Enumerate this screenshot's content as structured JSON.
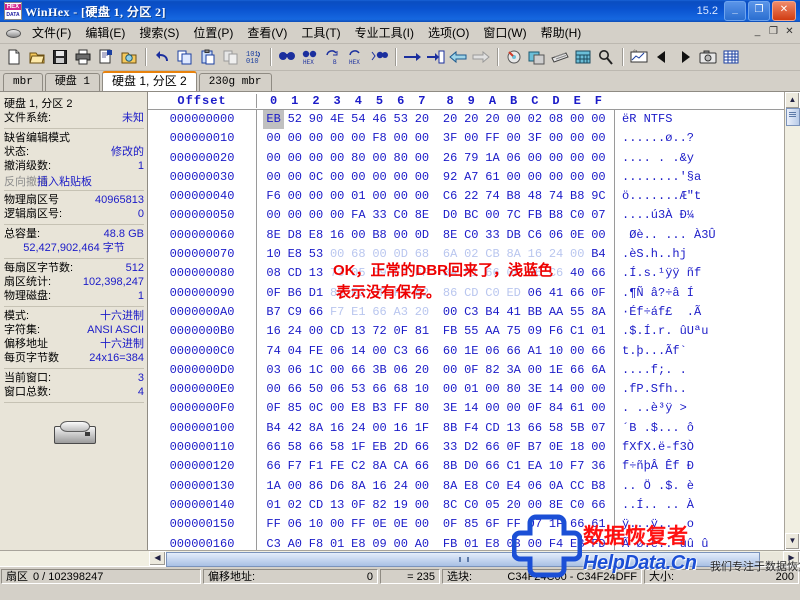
{
  "titlebar": {
    "title": "WinHex - [硬盘 1, 分区 2]",
    "version": "15.2",
    "minimize": "_",
    "maximize": "❐",
    "close": "✕"
  },
  "menu": {
    "items": [
      {
        "label": "文件(F)"
      },
      {
        "label": "编辑(E)"
      },
      {
        "label": "搜索(S)"
      },
      {
        "label": "位置(P)"
      },
      {
        "label": "查看(V)"
      },
      {
        "label": "工具(T)"
      },
      {
        "label": "专业工具(I)"
      },
      {
        "label": "选项(O)"
      },
      {
        "label": "窗口(W)"
      },
      {
        "label": "帮助(H)"
      }
    ],
    "mdi": {
      "minimize": "_",
      "restore": "❐",
      "close": "✕"
    }
  },
  "toolbar": {
    "buttons": [
      {
        "name": "new-file-icon",
        "glyph": "🗋"
      },
      {
        "name": "open-file-icon",
        "glyph": "📂"
      },
      {
        "name": "save-icon",
        "glyph": "💾"
      },
      {
        "name": "print-icon",
        "glyph": "🖨"
      },
      {
        "name": "properties-icon",
        "glyph": "🗒"
      },
      {
        "name": "open-disk-icon",
        "glyph": "📁"
      },
      {
        "name": "undo-icon",
        "glyph": "↶"
      },
      {
        "name": "copy-icon",
        "glyph": "⎘"
      },
      {
        "name": "paste-icon",
        "glyph": "📋"
      },
      {
        "name": "clipboard-data-icon",
        "glyph": "🗐"
      },
      {
        "name": "binary-101-icon",
        "glyph": "101"
      },
      {
        "name": "find-text-icon",
        "glyph": "🔍"
      },
      {
        "name": "find-hex-icon",
        "glyph": "HEX"
      },
      {
        "name": "replace-text-icon",
        "glyph": "↻"
      },
      {
        "name": "replace-hex-icon",
        "glyph": "HEX"
      },
      {
        "name": "find-all-icon",
        "glyph": "🔎"
      },
      {
        "name": "goto-offset-icon",
        "glyph": "→"
      },
      {
        "name": "goto-sector-icon",
        "glyph": "⇥"
      },
      {
        "name": "navigate-back-icon",
        "glyph": "⬅"
      },
      {
        "name": "navigate-forward-icon",
        "glyph": "➡"
      },
      {
        "name": "disk-tools-icon",
        "glyph": "💿"
      },
      {
        "name": "backup-icon",
        "glyph": "🖫"
      },
      {
        "name": "ram-icon",
        "glyph": "▤"
      },
      {
        "name": "calculator-icon",
        "glyph": "🖩"
      },
      {
        "name": "analyze-icon",
        "glyph": "🔍"
      },
      {
        "name": "graph-icon",
        "glyph": "📈"
      },
      {
        "name": "prev-icon",
        "glyph": "◀"
      },
      {
        "name": "next-icon",
        "glyph": "▶"
      },
      {
        "name": "snapshot-icon",
        "glyph": "📷"
      },
      {
        "name": "table-icon",
        "glyph": "▦"
      }
    ]
  },
  "tabs": [
    {
      "label": "mbr",
      "active": false
    },
    {
      "label": "硬盘 1",
      "active": false
    },
    {
      "label": "硬盘 1, 分区 2",
      "active": true
    },
    {
      "label": "230g mbr",
      "active": false
    }
  ],
  "infopane": {
    "groups": [
      {
        "rows": [
          {
            "key": "硬盘 1, 分区 2",
            "value": ""
          },
          {
            "key": "文件系统:",
            "value": "未知"
          }
        ]
      },
      {
        "rows": [
          {
            "key": "缺省编辑模式",
            "value": ""
          },
          {
            "key": "状态:",
            "value": "修改的"
          },
          {
            "key": "撤消级数:",
            "value": "1"
          },
          {
            "key": "反向撤消",
            "value": "插入粘贴板",
            "overlap": true
          }
        ]
      },
      {
        "rows": [
          {
            "key": "物理扇区号",
            "value": "40965813"
          },
          {
            "key": "逻辑扇区号:",
            "value": "0"
          }
        ]
      },
      {
        "rows": [
          {
            "key": "总容量:",
            "value": "48.8 GB"
          },
          {
            "key": "",
            "value": "52,427,902,464 字节",
            "center": true
          }
        ]
      },
      {
        "rows": [
          {
            "key": "每扇区字节数:",
            "value": "512"
          },
          {
            "key": "扇区统计:",
            "value": "102,398,247"
          },
          {
            "key": "物理磁盘:",
            "value": "1"
          }
        ]
      },
      {
        "rows": [
          {
            "key": "模式:",
            "value": "十六进制"
          },
          {
            "key": "字符集:",
            "value": "ANSI ASCII"
          },
          {
            "key": "偏移地址",
            "value": "十六进制"
          },
          {
            "key": "每页字节数",
            "value": "24x16=384"
          }
        ]
      },
      {
        "rows": [
          {
            "key": "当前窗口:",
            "value": "3"
          },
          {
            "key": "窗口总数:",
            "value": "4"
          }
        ]
      }
    ],
    "disk_icon": "hard-disk-icon"
  },
  "hexview": {
    "offset_header": "Offset",
    "columns": [
      "0",
      "1",
      "2",
      "3",
      "4",
      "5",
      "6",
      "7",
      "8",
      "9",
      "A",
      "B",
      "C",
      "D",
      "E",
      "F"
    ],
    "rows": [
      {
        "offset": "000000000",
        "bytes": [
          "EB",
          "52",
          "90",
          "4E",
          "54",
          "46",
          "53",
          "20",
          "20",
          "20",
          "20",
          "00",
          "02",
          "08",
          "00",
          "00"
        ],
        "unsaved": [],
        "sel": [
          0
        ],
        "ascii": "ëR NTFS"
      },
      {
        "offset": "000000010",
        "bytes": [
          "00",
          "00",
          "00",
          "00",
          "00",
          "F8",
          "00",
          "00",
          "3F",
          "00",
          "FF",
          "00",
          "3F",
          "00",
          "00",
          "00"
        ],
        "unsaved": [],
        "sel": [],
        "ascii": "......ø..?"
      },
      {
        "offset": "000000020",
        "bytes": [
          "00",
          "00",
          "00",
          "00",
          "80",
          "00",
          "80",
          "00",
          "26",
          "79",
          "1A",
          "06",
          "00",
          "00",
          "00",
          "00"
        ],
        "unsaved": [],
        "sel": [],
        "ascii": ".... . .&y"
      },
      {
        "offset": "000000030",
        "bytes": [
          "00",
          "00",
          "0C",
          "00",
          "00",
          "00",
          "00",
          "00",
          "92",
          "A7",
          "61",
          "00",
          "00",
          "00",
          "00",
          "00"
        ],
        "unsaved": [],
        "sel": [],
        "ascii": "........'§a"
      },
      {
        "offset": "000000040",
        "bytes": [
          "F6",
          "00",
          "00",
          "00",
          "01",
          "00",
          "00",
          "00",
          "C6",
          "22",
          "74",
          "B8",
          "48",
          "74",
          "B8",
          "9C"
        ],
        "unsaved": [],
        "sel": [],
        "ascii": "ö.......Æ\"t"
      },
      {
        "offset": "000000050",
        "bytes": [
          "00",
          "00",
          "00",
          "00",
          "FA",
          "33",
          "C0",
          "8E",
          "D0",
          "BC",
          "00",
          "7C",
          "FB",
          "B8",
          "C0",
          "07"
        ],
        "unsaved": [],
        "sel": [],
        "ascii": "....ú3À Ð¼"
      },
      {
        "offset": "000000060",
        "bytes": [
          "8E",
          "D8",
          "E8",
          "16",
          "00",
          "B8",
          "00",
          "0D",
          "8E",
          "C0",
          "33",
          "DB",
          "C6",
          "06",
          "0E",
          "00"
        ],
        "unsaved": [],
        "sel": [],
        "ascii": " Øè.. ... À3Û"
      },
      {
        "offset": "000000070",
        "bytes": [
          "10",
          "E8",
          "53",
          "00",
          "68",
          "00",
          "0D",
          "68",
          "6A",
          "02",
          "CB",
          "8A",
          "16",
          "24",
          "00",
          "B4"
        ],
        "unsaved": [
          3,
          4,
          5,
          6,
          7,
          8,
          9,
          10,
          11,
          12,
          13,
          14
        ],
        "sel": [],
        "ascii": ".èS.h..hj"
      },
      {
        "offset": "000000080",
        "bytes": [
          "08",
          "CD",
          "13",
          "73",
          "05",
          "B9",
          "FF",
          "FF",
          "8A",
          "F1",
          "66",
          "0F",
          "B6",
          "C6",
          "40",
          "66"
        ],
        "unsaved": [
          3,
          4,
          5,
          6,
          7,
          8,
          9,
          10,
          11,
          12,
          13
        ],
        "sel": [],
        "ascii": ".Í.s.¹ÿÿ ñf"
      },
      {
        "offset": "000000090",
        "bytes": [
          "0F",
          "B6",
          "D1",
          "80",
          "E2",
          "3F",
          "F7",
          "E2",
          "86",
          "CD",
          "C0",
          "ED",
          "06",
          "41",
          "66",
          "0F"
        ],
        "unsaved": [
          3,
          4,
          5,
          6,
          7,
          8,
          9,
          10,
          11
        ],
        "sel": [],
        "ascii": ".¶Ñ â?÷â Í"
      },
      {
        "offset": "0000000A0",
        "bytes": [
          "B7",
          "C9",
          "66",
          "F7",
          "E1",
          "66",
          "A3",
          "20",
          "00",
          "C3",
          "B4",
          "41",
          "BB",
          "AA",
          "55",
          "8A"
        ],
        "unsaved": [
          3,
          4,
          5,
          6,
          7
        ],
        "sel": [],
        "ascii": "·Éf÷áf£  .Ã"
      },
      {
        "offset": "0000000B0",
        "bytes": [
          "16",
          "24",
          "00",
          "CD",
          "13",
          "72",
          "0F",
          "81",
          "FB",
          "55",
          "AA",
          "75",
          "09",
          "F6",
          "C1",
          "01"
        ],
        "unsaved": [],
        "sel": [],
        "ascii": ".$.Í.r. ûUªu"
      },
      {
        "offset": "0000000C0",
        "bytes": [
          "74",
          "04",
          "FE",
          "06",
          "14",
          "00",
          "C3",
          "66",
          "60",
          "1E",
          "06",
          "66",
          "A1",
          "10",
          "00",
          "66"
        ],
        "unsaved": [],
        "sel": [],
        "ascii": "t.þ...Ãf`"
      },
      {
        "offset": "0000000D0",
        "bytes": [
          "03",
          "06",
          "1C",
          "00",
          "66",
          "3B",
          "06",
          "20",
          "00",
          "0F",
          "82",
          "3A",
          "00",
          "1E",
          "66",
          "6A"
        ],
        "unsaved": [],
        "sel": [],
        "ascii": "....f;. ."
      },
      {
        "offset": "0000000E0",
        "bytes": [
          "00",
          "66",
          "50",
          "06",
          "53",
          "66",
          "68",
          "10",
          "00",
          "01",
          "00",
          "80",
          "3E",
          "14",
          "00",
          "00"
        ],
        "unsaved": [],
        "sel": [],
        "ascii": ".fP.Sfh.."
      },
      {
        "offset": "0000000F0",
        "bytes": [
          "0F",
          "85",
          "0C",
          "00",
          "E8",
          "B3",
          "FF",
          "80",
          "3E",
          "14",
          "00",
          "00",
          "0F",
          "84",
          "61",
          "00"
        ],
        "unsaved": [],
        "sel": [],
        "ascii": ". ..è³ÿ >"
      },
      {
        "offset": "000000100",
        "bytes": [
          "B4",
          "42",
          "8A",
          "16",
          "24",
          "00",
          "16",
          "1F",
          "8B",
          "F4",
          "CD",
          "13",
          "66",
          "58",
          "5B",
          "07"
        ],
        "unsaved": [],
        "sel": [],
        "ascii": "´B .$... ô"
      },
      {
        "offset": "000000110",
        "bytes": [
          "66",
          "58",
          "66",
          "58",
          "1F",
          "EB",
          "2D",
          "66",
          "33",
          "D2",
          "66",
          "0F",
          "B7",
          "0E",
          "18",
          "00"
        ],
        "unsaved": [],
        "sel": [],
        "ascii": "fXfX.ë-f3Ò"
      },
      {
        "offset": "000000120",
        "bytes": [
          "66",
          "F7",
          "F1",
          "FE",
          "C2",
          "8A",
          "CA",
          "66",
          "8B",
          "D0",
          "66",
          "C1",
          "EA",
          "10",
          "F7",
          "36"
        ],
        "unsaved": [],
        "sel": [],
        "ascii": "f÷ñþÂ Êf Ð"
      },
      {
        "offset": "000000130",
        "bytes": [
          "1A",
          "00",
          "86",
          "D6",
          "8A",
          "16",
          "24",
          "00",
          "8A",
          "E8",
          "C0",
          "E4",
          "06",
          "0A",
          "CC",
          "B8"
        ],
        "unsaved": [],
        "sel": [],
        "ascii": ".. Ö .$. è"
      },
      {
        "offset": "000000140",
        "bytes": [
          "01",
          "02",
          "CD",
          "13",
          "0F",
          "82",
          "19",
          "00",
          "8C",
          "C0",
          "05",
          "20",
          "00",
          "8E",
          "C0",
          "66"
        ],
        "unsaved": [],
        "sel": [],
        "ascii": "..Í.. .. À"
      },
      {
        "offset": "000000150",
        "bytes": [
          "FF",
          "06",
          "10",
          "00",
          "FF",
          "0E",
          "0E",
          "00",
          "0F",
          "85",
          "6F",
          "FF",
          "07",
          "1F",
          "66",
          "61"
        ],
        "unsaved": [],
        "sel": [],
        "ascii": "ÿ...ÿ... o"
      },
      {
        "offset": "000000160",
        "bytes": [
          "C3",
          "A0",
          "F8",
          "01",
          "E8",
          "09",
          "00",
          "A0",
          "FB",
          "01",
          "E8",
          "03",
          "00",
          "F4",
          "EB",
          "FD"
        ],
        "unsaved": [],
        "sel": [],
        "ascii": "Ã ø.è.. ûû û"
      }
    ]
  },
  "annotation": {
    "line1": "OK，正常的DBR回来了，浅蓝色",
    "line2": "表示没有保存。"
  },
  "watermark": {
    "red_text": "数据恢复者",
    "brand": "HelpData.Cn",
    "subtitle": "我们专注于数据恢复"
  },
  "statusbar": {
    "sector_label": "扇区",
    "sector_value": "0 / 102398247",
    "offset_label": "偏移地址:",
    "offset_value": "0",
    "equals": "= 235",
    "block_label": "选块:",
    "block_value": "C34F24C00 - C34F24DFF",
    "size_label": "大小:",
    "size_value": "200"
  },
  "scrollbars": {
    "up_arrow": "▲",
    "down_arrow": "▼",
    "left_arrow": "◀",
    "right_arrow": "▶"
  },
  "colors": {
    "accent_blue": "#1b1bc8",
    "unsaved_blue": "#b9c6ef",
    "annotation_red": "#ee0000",
    "chrome": "#d4d0c8",
    "infopane": "#e8e4d8",
    "tab_active_top": "#e8820c"
  }
}
